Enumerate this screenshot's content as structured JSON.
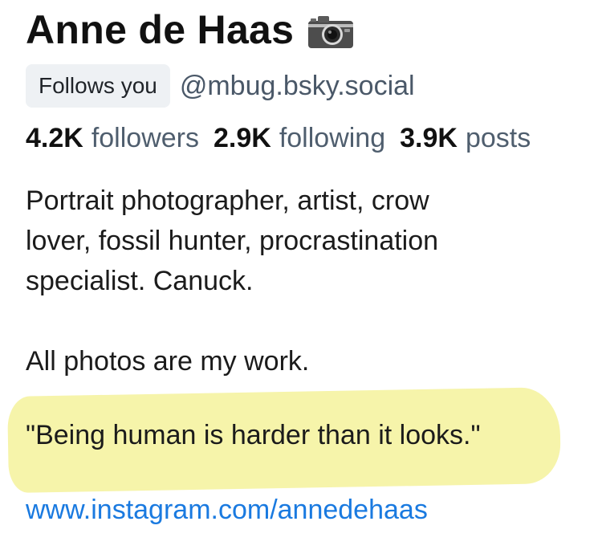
{
  "profile": {
    "display_name": "Anne de Haas",
    "name_icon": "camera-icon",
    "follows_badge": "Follows you",
    "handle": "@mbug.bsky.social"
  },
  "stats": {
    "followers_count": "4.2K",
    "followers_label": "followers",
    "following_count": "2.9K",
    "following_label": "following",
    "posts_count": "3.9K",
    "posts_label": "posts"
  },
  "bio": {
    "line1": "Portrait photographer, artist, crow",
    "line2": "lover, fossil hunter, procrastination",
    "line3": "specialist. Canuck.",
    "line4": "All photos are my work.",
    "quote": "\"Being human is harder than it looks.\"",
    "link": "www.instagram.com/annedehaas"
  },
  "colors": {
    "handle": "#4a5868",
    "link": "#1a7ae0",
    "highlight": "#f6f3a5"
  }
}
